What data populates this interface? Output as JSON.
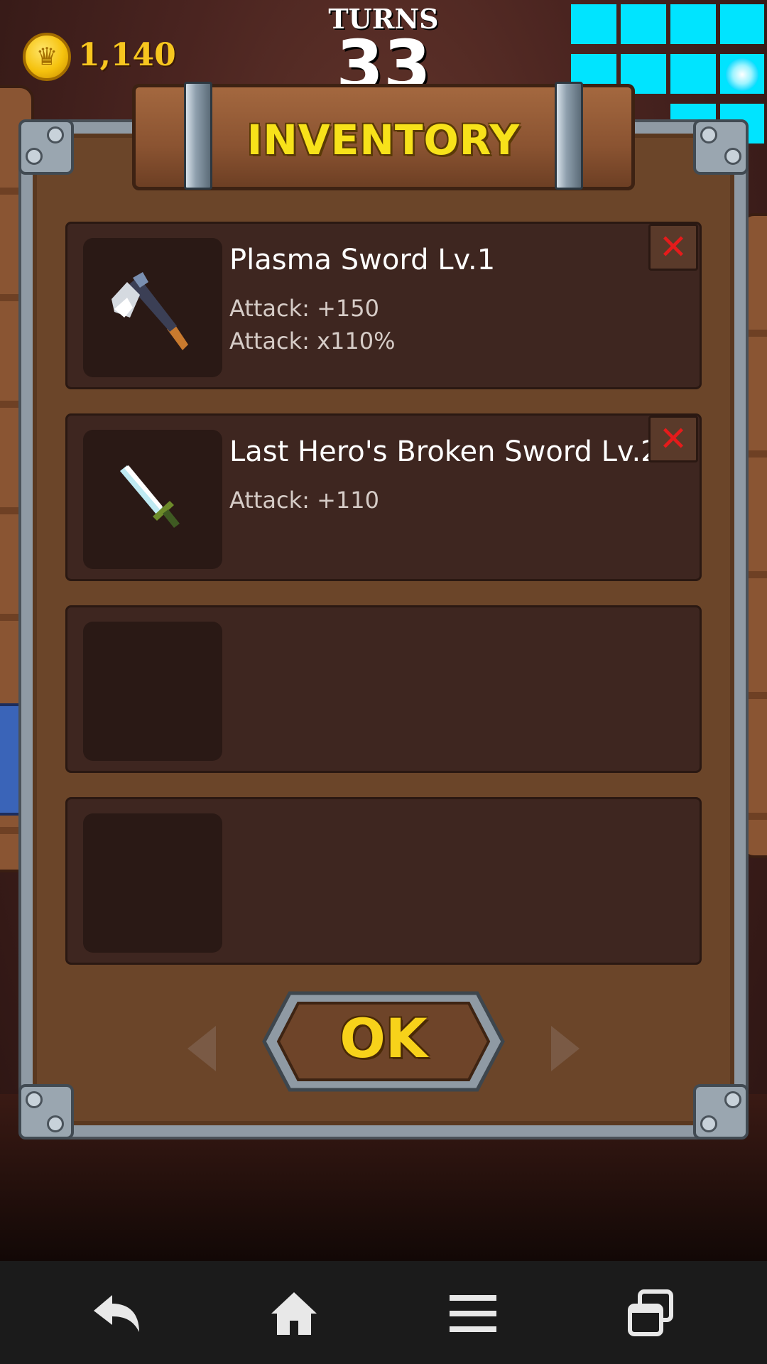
{
  "hud": {
    "coins": "1,140",
    "turns_label": "TURNS",
    "turns_value": "33",
    "coin_icon": "crown-coin-icon"
  },
  "dialog": {
    "title": "INVENTORY",
    "ok_label": "OK",
    "slots": [
      {
        "name": "Plasma Sword  Lv.1",
        "stats": [
          "Attack: +150",
          "Attack: x110%"
        ],
        "icon": "axe-icon",
        "removable": true
      },
      {
        "name": "Last Hero's Broken Sword  Lv.2",
        "stats": [
          "Attack: +110"
        ],
        "icon": "sword-icon",
        "removable": true
      },
      {
        "name": "",
        "stats": [],
        "icon": "",
        "removable": false
      },
      {
        "name": "",
        "stats": [],
        "icon": "",
        "removable": false
      }
    ]
  },
  "colors": {
    "gold": "#f7c61f",
    "title_yellow": "#f7e21a",
    "remove_red": "#e51b1b",
    "minimap_cyan": "#00e4ff",
    "slot_bg": "#3e2620"
  },
  "navbar": {
    "icons": [
      "back-icon",
      "home-icon",
      "menu-icon",
      "recent-apps-icon"
    ]
  }
}
